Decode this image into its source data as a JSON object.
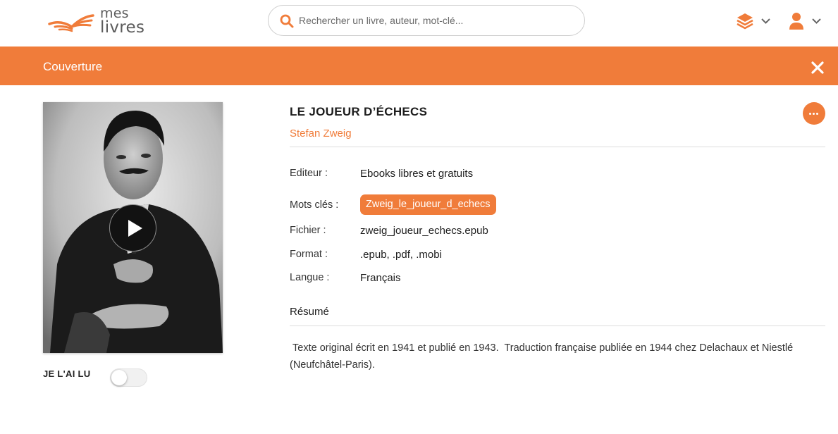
{
  "header": {
    "logo": {
      "line1": "mes",
      "line2": "livres"
    },
    "search": {
      "placeholder": "Rechercher un livre, auteur, mot-clé..."
    },
    "icons": {
      "books": "books-stack-icon",
      "user": "user-icon",
      "chevron": "chevron-down-icon",
      "search": "search-icon"
    }
  },
  "band": {
    "title": "Couverture",
    "close_icon": "close-icon"
  },
  "book": {
    "title": "LE JOUEUR D’ÉCHECS",
    "author": "Stefan Zweig",
    "more_icon": "more-icon",
    "details": {
      "editeur_label": "Editeur :",
      "editeur_value": "Ebooks libres et gratuits",
      "keywords_label": "Mots clés :",
      "keywords": [
        "Zweig_le_joueur_d_echecs"
      ],
      "fichier_label": "Fichier :",
      "fichier_value": "zweig_joueur_echecs.epub",
      "format_label": "Format :",
      "format_value": ".epub, .pdf, .mobi",
      "langue_label": "Langue :",
      "langue_value": "Français"
    },
    "resume_label": "Résumé",
    "resume_text": " Texte original écrit en 1941 et publié en 1943.  Traduction française publiée en 1944 chez Delachaux et Niestlé (Neufchâtel-Paris)."
  },
  "cover": {
    "play_icon": "play-icon"
  },
  "read_toggle": {
    "label": "JE L'AI LU",
    "checked": false
  },
  "colors": {
    "accent": "#f07c3a",
    "text": "#1d1d1d",
    "border": "#dcdcdc"
  }
}
